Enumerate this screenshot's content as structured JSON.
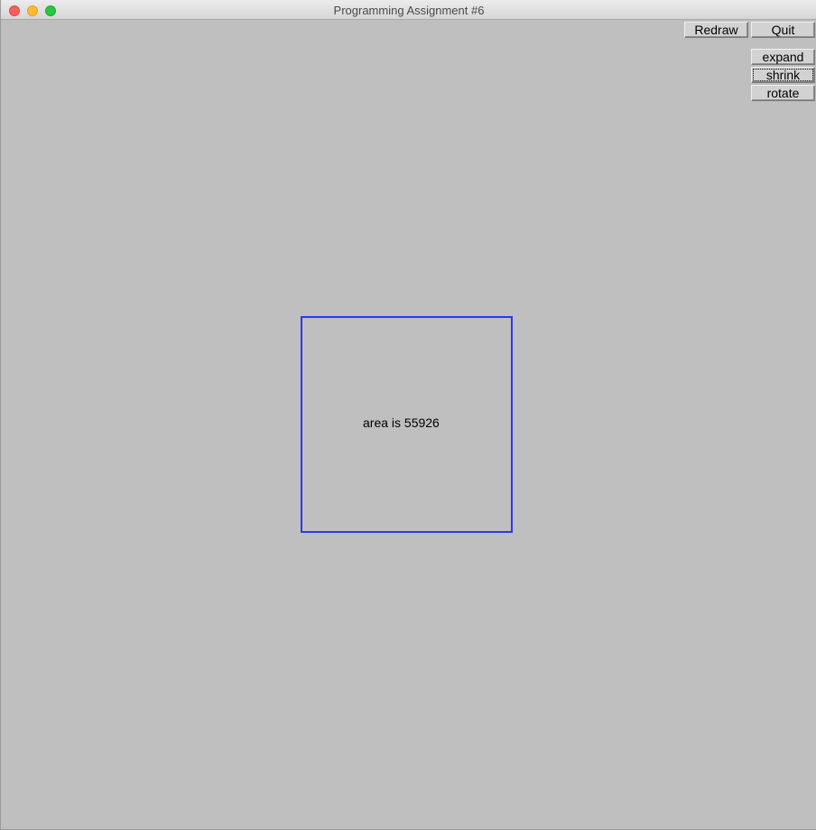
{
  "window": {
    "title": "Programming Assignment #6"
  },
  "toolbar": {
    "redraw_label": "Redraw",
    "quit_label": "Quit"
  },
  "transform_buttons": {
    "expand_label": "expand",
    "shrink_label": "shrink",
    "rotate_label": "rotate"
  },
  "canvas": {
    "background_color": "#bfbfbf",
    "shape_color": "#2a39f0",
    "area_text": "area is 55926"
  }
}
